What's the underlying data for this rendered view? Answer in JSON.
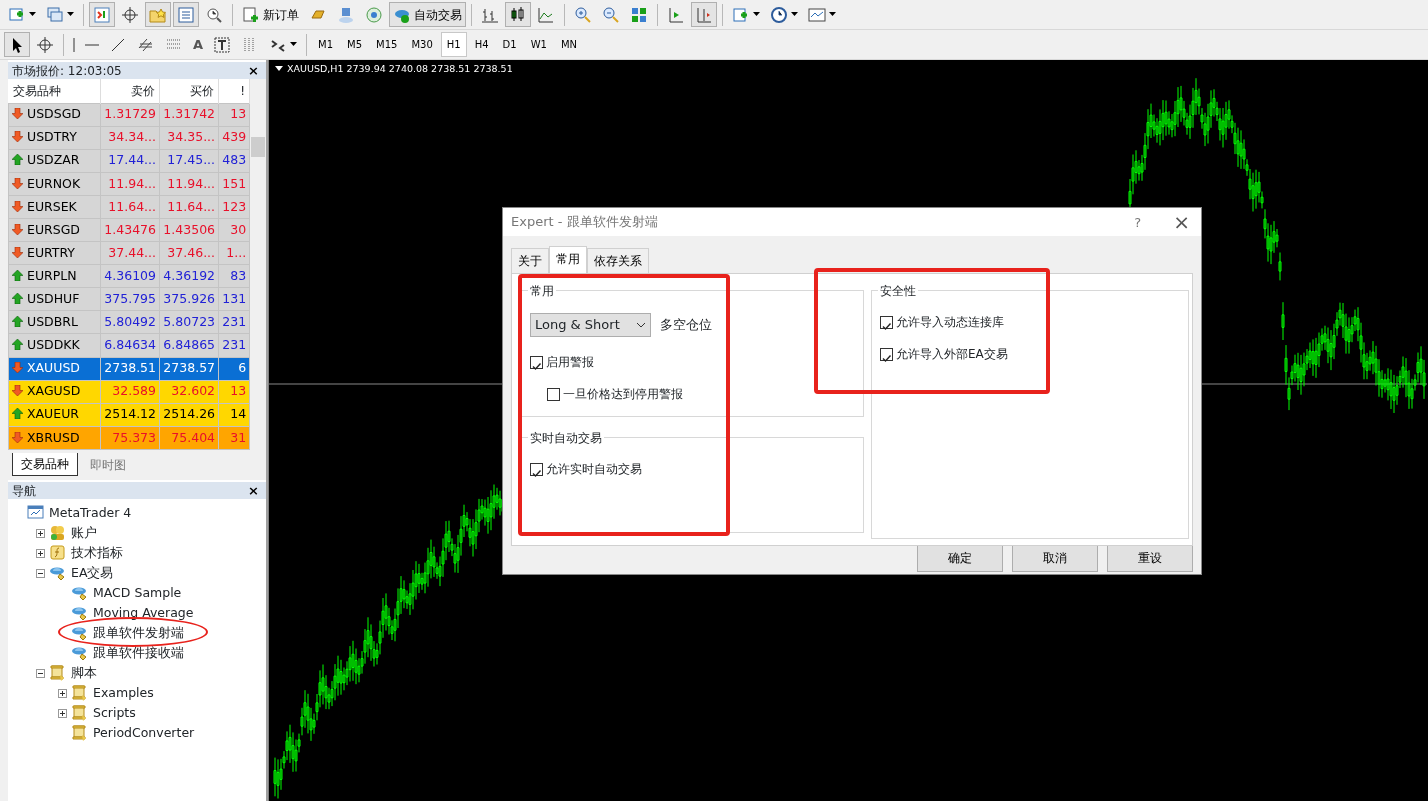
{
  "toolbar_1": [
    {
      "kind": "icon",
      "dropdown": true,
      "pressed": false
    },
    {
      "kind": "icon",
      "dropdown": true,
      "pressed": false
    },
    {
      "kind": "sep"
    },
    {
      "kind": "icon",
      "pressed": true
    },
    {
      "kind": "icon",
      "pressed": false
    },
    {
      "kind": "icon",
      "pressed": true
    },
    {
      "kind": "icon",
      "pressed": true
    },
    {
      "kind": "icon",
      "pressed": false
    },
    {
      "kind": "sep"
    },
    {
      "kind": "text",
      "label": "新订单",
      "pressed": false
    },
    {
      "kind": "icon",
      "pressed": false
    },
    {
      "kind": "icon",
      "pressed": false
    },
    {
      "kind": "icon",
      "pressed": false
    },
    {
      "kind": "text",
      "label": "自动交易",
      "pressed": true
    },
    {
      "kind": "sep"
    },
    {
      "kind": "icon",
      "pressed": false
    },
    {
      "kind": "icon",
      "pressed": true
    },
    {
      "kind": "icon",
      "pressed": false
    },
    {
      "kind": "sep"
    },
    {
      "kind": "icon",
      "pressed": false
    },
    {
      "kind": "icon",
      "pressed": false
    },
    {
      "kind": "icon",
      "pressed": false
    },
    {
      "kind": "sep"
    },
    {
      "kind": "icon",
      "pressed": false
    },
    {
      "kind": "icon",
      "pressed": true
    },
    {
      "kind": "sep"
    },
    {
      "kind": "icon",
      "dropdown": true,
      "pressed": false
    },
    {
      "kind": "icon",
      "dropdown": true,
      "pressed": false
    },
    {
      "kind": "icon",
      "dropdown": true,
      "pressed": false
    }
  ],
  "toolbar_2": [
    {
      "kind": "icon",
      "pressed": true
    },
    {
      "kind": "icon",
      "pressed": false
    },
    {
      "kind": "sep"
    },
    {
      "kind": "icon",
      "pressed": false
    },
    {
      "kind": "icon",
      "pressed": false
    },
    {
      "kind": "icon",
      "pressed": false
    },
    {
      "kind": "icon",
      "pressed": false
    },
    {
      "kind": "icon",
      "pressed": false
    },
    {
      "kind": "text",
      "label": "A",
      "pressed": false
    },
    {
      "kind": "icon",
      "pressed": false
    },
    {
      "kind": "icon",
      "pressed": false
    },
    {
      "kind": "icon",
      "dropdown": true,
      "pressed": false
    },
    {
      "kind": "sep"
    }
  ],
  "timeframes": [
    {
      "label": "M1",
      "selected": false
    },
    {
      "label": "M5",
      "selected": false
    },
    {
      "label": "M15",
      "selected": false
    },
    {
      "label": "M30",
      "selected": false
    },
    {
      "label": "H1",
      "selected": true
    },
    {
      "label": "H4",
      "selected": false
    },
    {
      "label": "D1",
      "selected": false
    },
    {
      "label": "W1",
      "selected": false
    },
    {
      "label": "MN",
      "selected": false
    }
  ],
  "market_watch": {
    "title": "市场报价: 12:03:05",
    "close": "×",
    "columns": [
      "交易品种",
      "卖价",
      "买价",
      "!"
    ],
    "rows": [
      {
        "symbol": "USDSGD",
        "bid": "1.31729",
        "ask": "1.31742",
        "spread": "13",
        "rising": false,
        "selected": false
      },
      {
        "symbol": "USDTRY",
        "bid": "34.34...",
        "ask": "34.35...",
        "spread": "439",
        "rising": false,
        "selected": false
      },
      {
        "symbol": "USDZAR",
        "bid": "17.44...",
        "ask": "17.45...",
        "spread": "483",
        "rising": true,
        "selected": false
      },
      {
        "symbol": "EURNOK",
        "bid": "11.94...",
        "ask": "11.94...",
        "spread": "151",
        "rising": false,
        "selected": false
      },
      {
        "symbol": "EURSEK",
        "bid": "11.64...",
        "ask": "11.64...",
        "spread": "123",
        "rising": false,
        "selected": false
      },
      {
        "symbol": "EURSGD",
        "bid": "1.43476",
        "ask": "1.43506",
        "spread": "30",
        "rising": false,
        "selected": false
      },
      {
        "symbol": "EURTRY",
        "bid": "37.44...",
        "ask": "37.46...",
        "spread": "1...",
        "rising": false,
        "selected": false
      },
      {
        "symbol": "EURPLN",
        "bid": "4.36109",
        "ask": "4.36192",
        "spread": "83",
        "rising": true,
        "selected": false
      },
      {
        "symbol": "USDHUF",
        "bid": "375.795",
        "ask": "375.926",
        "spread": "131",
        "rising": true,
        "selected": false
      },
      {
        "symbol": "USDBRL",
        "bid": "5.80492",
        "ask": "5.80723",
        "spread": "231",
        "rising": true,
        "selected": false
      },
      {
        "symbol": "USDDKK",
        "bid": "6.84634",
        "ask": "6.84865",
        "spread": "231",
        "rising": true,
        "selected": false
      },
      {
        "symbol": "XAUUSD",
        "bid": "2738.51",
        "ask": "2738.57",
        "spread": "6",
        "rising": false,
        "selected": true
      },
      {
        "symbol": "XAGUSD",
        "bid": "32.589",
        "ask": "32.602",
        "spread": "13",
        "rising": false,
        "selected": false,
        "color": "#ffd700"
      },
      {
        "symbol": "XAUEUR",
        "bid": "2514.12",
        "ask": "2514.26",
        "spread": "14",
        "rising": true,
        "selected": false,
        "color": "#ffd700"
      },
      {
        "symbol": "XBRUSD",
        "bid": "75.373",
        "ask": "75.404",
        "spread": "31",
        "rising": false,
        "selected": false,
        "color": "#ffa500"
      }
    ],
    "tabs": [
      {
        "label": "交易品种",
        "selected": true
      },
      {
        "label": "即时图",
        "selected": false
      }
    ]
  },
  "navigator": {
    "title": "导航",
    "close": "×",
    "tree": [
      {
        "label": "MetaTrader 4",
        "kind": "root",
        "children": [
          {
            "label": "账户",
            "kind": "accounts",
            "expanded": false
          },
          {
            "label": "技术指标",
            "kind": "indicators",
            "expanded": false
          },
          {
            "label": "EA交易",
            "kind": "experts",
            "expanded": true,
            "children": [
              {
                "label": "MACD Sample",
                "kind": "expert"
              },
              {
                "label": "Moving Average",
                "kind": "expert"
              },
              {
                "label": "跟单软件发射端",
                "kind": "expert",
                "circled": true
              },
              {
                "label": "跟单软件接收端",
                "kind": "expert"
              }
            ]
          },
          {
            "label": "脚本",
            "kind": "scripts",
            "expanded": true,
            "children": [
              {
                "label": "Examples",
                "kind": "script",
                "expanded": false
              },
              {
                "label": "Scripts",
                "kind": "script",
                "expanded": false
              },
              {
                "label": "PeriodConverter",
                "kind": "script"
              }
            ]
          }
        ]
      }
    ]
  },
  "chart": {
    "caption": "XAUUSD,H1  2739.94 2740.08 2738.51 2738.51"
  },
  "dialog": {
    "title": "Expert - 跟单软件发射端",
    "help": "?",
    "close": "×",
    "tabs": [
      {
        "label": "关于",
        "selected": false
      },
      {
        "label": "常用",
        "selected": true
      },
      {
        "label": "依存关系",
        "selected": false
      }
    ],
    "left_column": [
      {
        "title": "常用",
        "items": [
          {
            "kind": "select",
            "value": "Long & Short",
            "description": "多空仓位"
          },
          {
            "kind": "checkbox",
            "label": "启用警报",
            "checked": true
          },
          {
            "kind": "checkbox",
            "label": "一旦价格达到停用警报",
            "checked": false,
            "indented": true
          }
        ]
      },
      {
        "title": "实时自动交易",
        "items": [
          {
            "kind": "checkbox",
            "label": "允许实时自动交易",
            "checked": true
          }
        ]
      }
    ],
    "right_column": [
      {
        "title": "安全性",
        "items": [
          {
            "kind": "checkbox",
            "label": "允许导入动态连接库",
            "checked": true
          },
          {
            "kind": "checkbox",
            "label": "允许导入外部EA交易",
            "checked": true
          }
        ]
      }
    ],
    "buttons": [
      "确定",
      "取消",
      "重设"
    ],
    "annotations": [
      {
        "kind": "rectangle"
      },
      {
        "kind": "rectangle"
      }
    ]
  }
}
